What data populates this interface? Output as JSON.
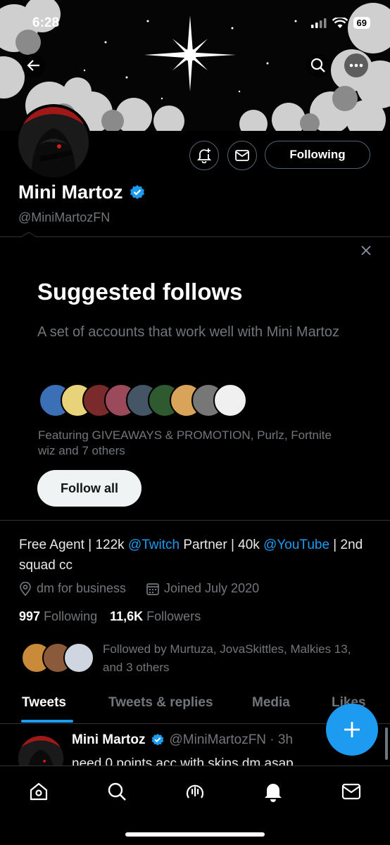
{
  "status_bar": {
    "time": "6:28",
    "battery": "69"
  },
  "profile": {
    "name": "Mini Martoz",
    "handle": "@MiniMartozFN",
    "following_button": "Following",
    "bio_parts": [
      "Free Agent | 122k ",
      "@Twitch",
      " Partner | 40k ",
      "@YouTube",
      " | 2nd squad cc"
    ],
    "location": "dm for business",
    "joined": "Joined July 2020",
    "following_count": "997",
    "following_label": "Following",
    "followers_count": "11,6K",
    "followers_label": "Followers",
    "followed_by": "Followed by Murtuza, JovaSkittles, Malkies 13, and 3 others"
  },
  "suggested": {
    "title": "Suggested follows",
    "description": "A set of accounts that work well with Mini Martoz",
    "featuring": "Featuring GIVEAWAYS & PROMOTION, Purlz, Fortnite wiz and 7 others",
    "follow_all": "Follow all",
    "avatar_colors": [
      "#3b6fb6",
      "#e8d27a",
      "#7a2a2a",
      "#9a4a5a",
      "#445566",
      "#2f5a2f",
      "#d9a35a",
      "#777777",
      "#f0f0f0"
    ]
  },
  "tabs": [
    "Tweets",
    "Tweets & replies",
    "Media",
    "Likes"
  ],
  "tweet": {
    "name": "Mini Martoz",
    "meta": "@MiniMartozFN · 3h",
    "text": "need 0 points acc with skins dm asap"
  },
  "nav": [
    "home-icon",
    "search-icon",
    "spaces-icon",
    "notifications-icon",
    "messages-icon"
  ],
  "colors": {
    "accent": "#1d9bf0",
    "background": "#000000",
    "muted": "#71767b"
  }
}
